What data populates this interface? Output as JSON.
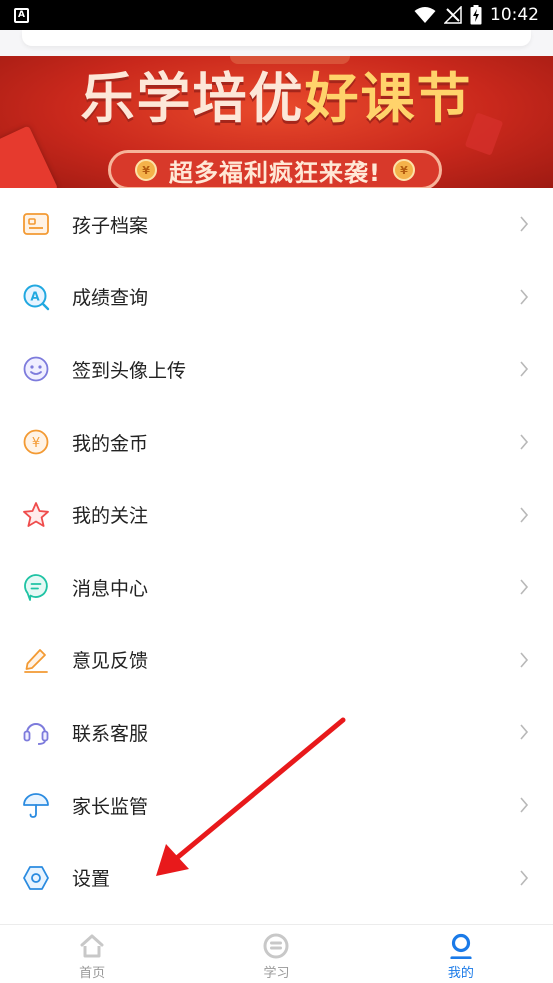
{
  "status_bar": {
    "left_badge": "A",
    "time": "10:42",
    "icons": [
      "wifi-icon",
      "no-signal-icon",
      "battery-charging-icon"
    ]
  },
  "banner": {
    "title_part1": "乐学培优",
    "title_part2": "好课节",
    "subtitle": "超多福利疯狂来袭!",
    "coin_symbol": "¥",
    "colors": {
      "background": "#c9281c",
      "title": "#fde7d8",
      "highlight": "#ffd36b"
    }
  },
  "menu": {
    "items": [
      {
        "label": "孩子档案",
        "icon": "id-card-icon"
      },
      {
        "label": "成绩查询",
        "icon": "grade-search-icon"
      },
      {
        "label": "签到头像上传",
        "icon": "smiley-face-icon"
      },
      {
        "label": "我的金币",
        "icon": "coin-icon"
      },
      {
        "label": "我的关注",
        "icon": "star-icon"
      },
      {
        "label": "消息中心",
        "icon": "message-bubble-icon"
      },
      {
        "label": "意见反馈",
        "icon": "edit-pencil-icon"
      },
      {
        "label": "联系客服",
        "icon": "headset-icon"
      },
      {
        "label": "家长监管",
        "icon": "umbrella-icon"
      },
      {
        "label": "设置",
        "icon": "settings-hexagon-icon"
      }
    ]
  },
  "bottom_nav": {
    "items": [
      {
        "label": "首页",
        "icon": "home-icon",
        "active": false
      },
      {
        "label": "学习",
        "icon": "study-icon",
        "active": false
      },
      {
        "label": "我的",
        "icon": "profile-icon",
        "active": true
      }
    ],
    "active_color": "#1a7ae8",
    "inactive_color": "#999999"
  },
  "annotation": {
    "type": "red-arrow",
    "color": "#e8191b",
    "points_to": "设置"
  }
}
